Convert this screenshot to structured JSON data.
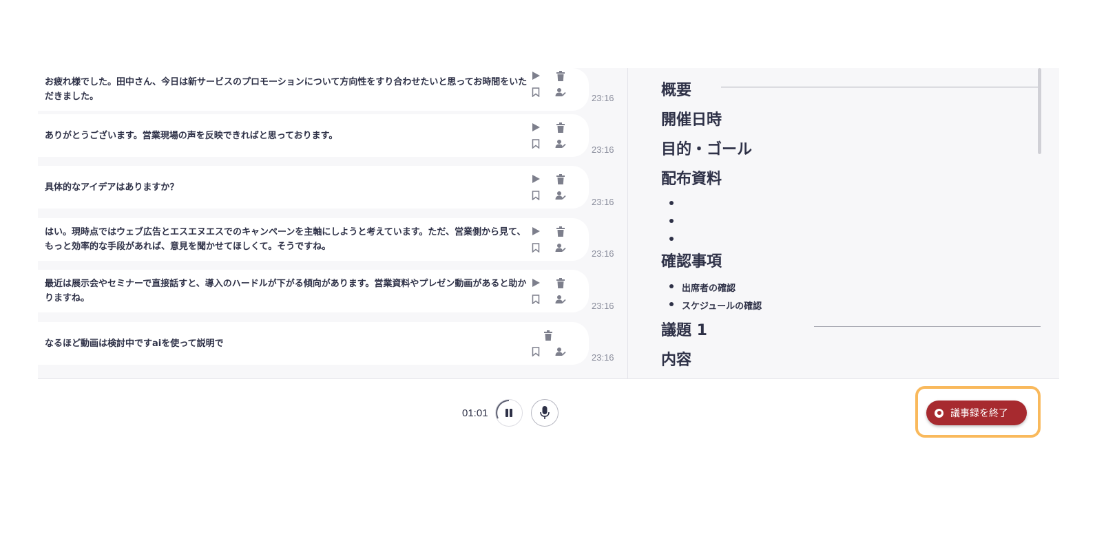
{
  "transcript": [
    {
      "text": "お疲れ様でした。田中さん、今日は新サービスのプロモーションについて方向性をすり合わせたいと思ってお時間をいただきました。",
      "time": "23:16",
      "play": true
    },
    {
      "text": "ありがとうございます。営業現場の声を反映できればと思っております。",
      "time": "23:16",
      "play": true
    },
    {
      "text": "具体的なアイデアはありますか？",
      "time": "23:16",
      "play": true
    },
    {
      "text": "はい。現時点ではウェブ広告とエスエヌエスでのキャンペーンを主軸にしようと考えています。ただ、営業側から見て、もっと効率的な手段があれば、意見を聞かせてほしくて。そうですね。",
      "time": "23:16",
      "play": true
    },
    {
      "text": "最近は展示会やセミナーで直接話すと、導入のハードルが下がる傾向があります。営業資料やプレゼン動画があると助かりますね。",
      "time": "23:16",
      "play": true
    },
    {
      "text": "なるほど動画は検討中ですaiを使って説明で",
      "time": "23:16",
      "play": false
    }
  ],
  "summary": {
    "overview": "概要",
    "datetime": "開催日時",
    "goal": "目的・ゴール",
    "materials": "配布資料",
    "confirm": "確認事項",
    "confirm_items": [
      "出席者の確認",
      "スケジュールの確認"
    ],
    "agenda1": "議題 1",
    "content": "内容"
  },
  "controls": {
    "elapsed": "01:01",
    "end_label": "議事録を終了"
  },
  "colors": {
    "accent": "#a72a2f",
    "highlight": "#f9b95c",
    "text": "#2e3147"
  }
}
